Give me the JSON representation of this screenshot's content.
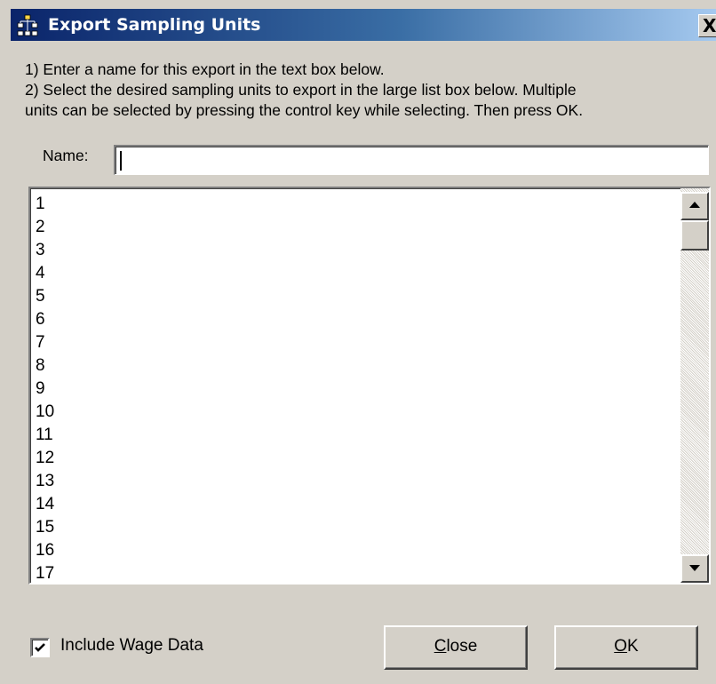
{
  "window": {
    "title": "Export Sampling Units",
    "close_glyph": "X",
    "icon": "hierarchy-icon",
    "titlebar_colors": [
      "#0a246a",
      "#a6caf0"
    ]
  },
  "instructions": {
    "line1": "1) Enter a name for this export in the text box below.",
    "line2": "2) Select the desired sampling units to export in the large list box below.  Multiple",
    "line3": "units can be selected by pressing the control key while selecting. Then press OK."
  },
  "name_field": {
    "label": "Name:",
    "value": ""
  },
  "sampling_units": [
    "1",
    "2",
    "3",
    "4",
    "5",
    "6",
    "7",
    "8",
    "9",
    "10",
    "11",
    "12",
    "13",
    "14",
    "15",
    "16",
    "17"
  ],
  "include_wage": {
    "label": "Include Wage Data",
    "checked": true
  },
  "buttons": {
    "close": {
      "mnemonic": "C",
      "rest": "lose"
    },
    "ok": {
      "mnemonic": "O",
      "rest": "K"
    }
  }
}
